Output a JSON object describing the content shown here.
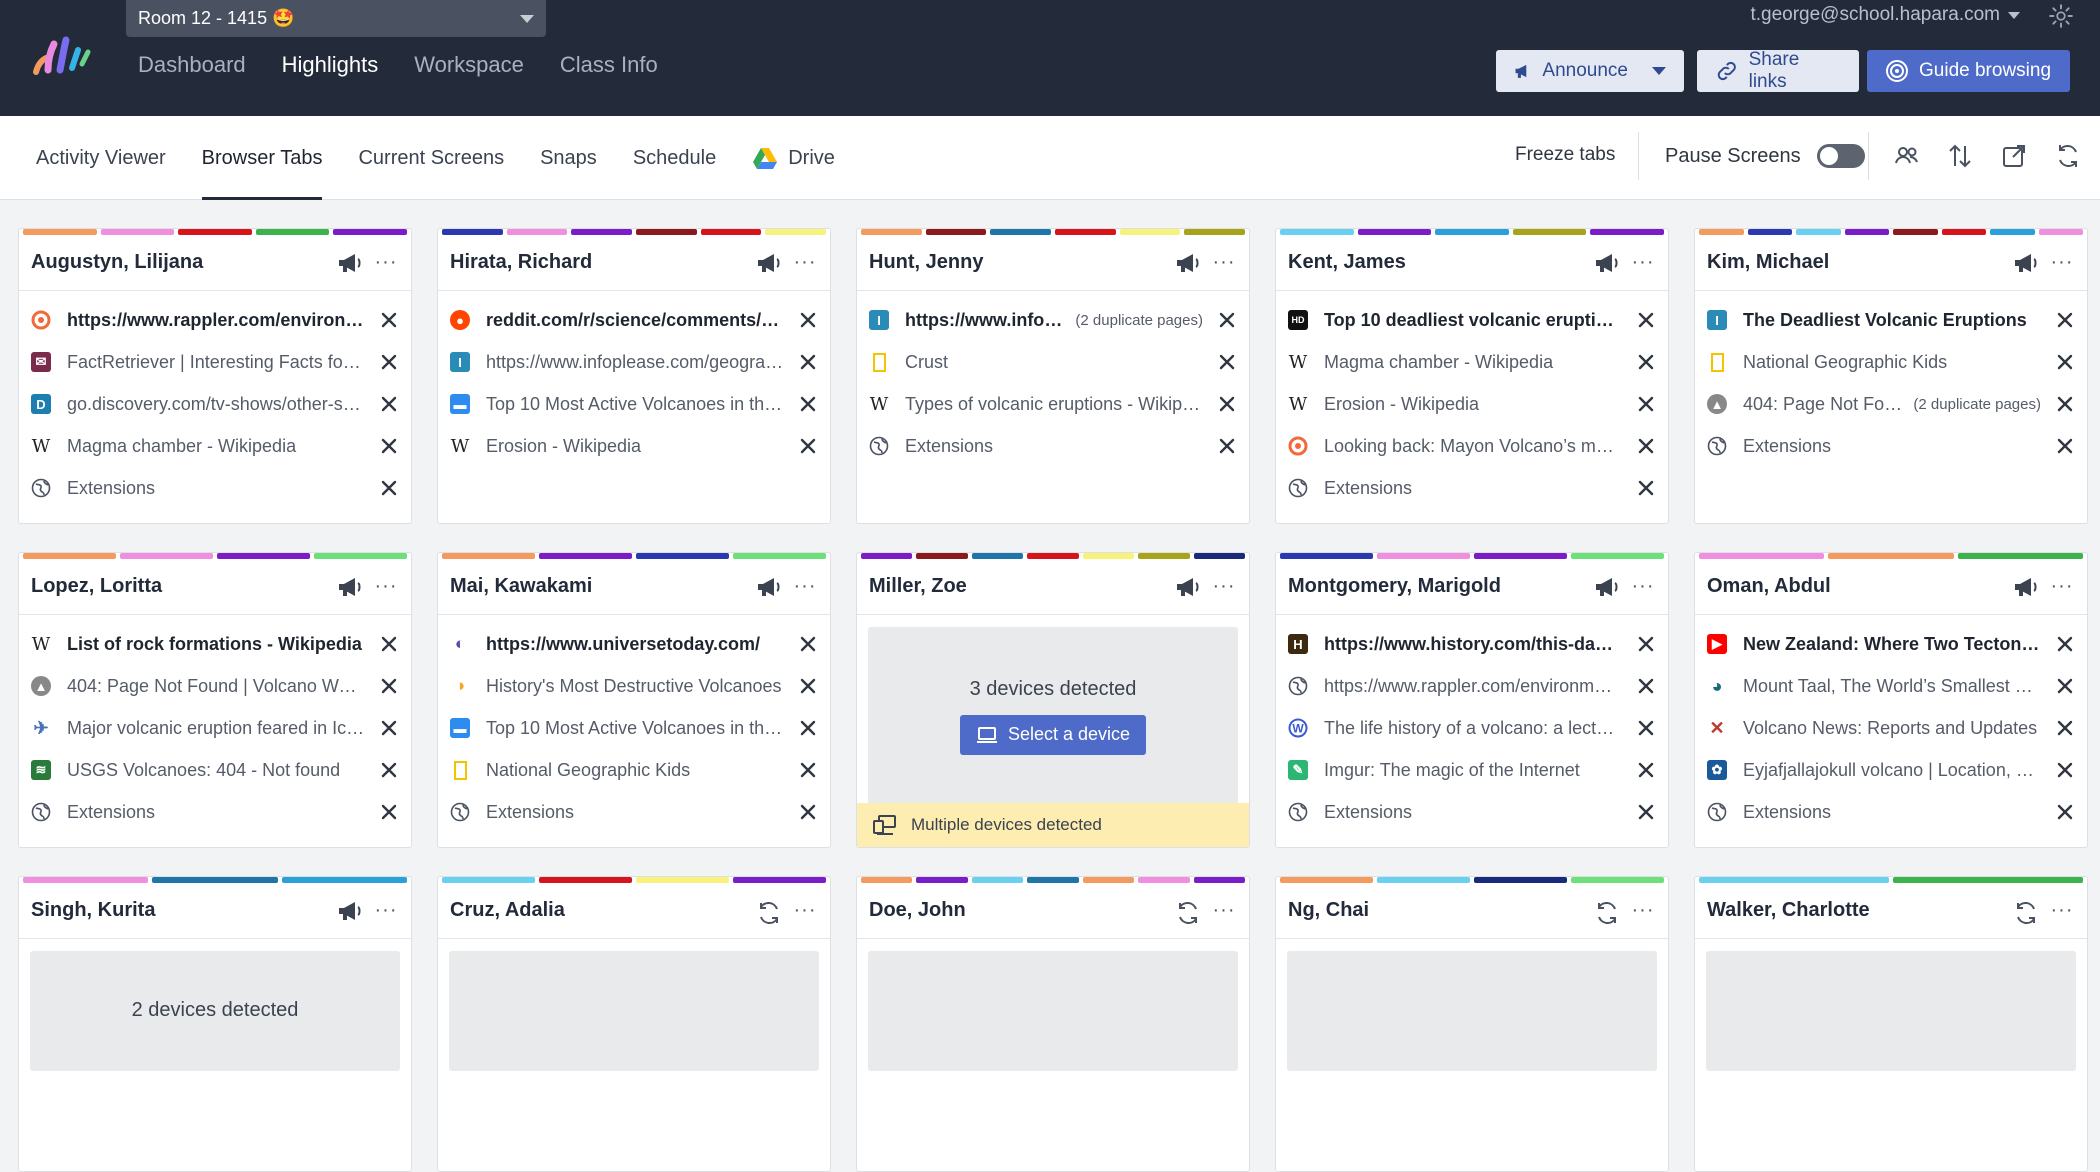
{
  "header": {
    "room": "Room 12 - 1415 🤩",
    "nav": [
      "Dashboard",
      "Highlights",
      "Workspace",
      "Class Info"
    ],
    "active_nav": "Highlights",
    "user": "t.george@school.hapara.com",
    "buttons": {
      "announce": "Announce",
      "share": "Share links",
      "guide": "Guide browsing"
    }
  },
  "subnav": {
    "tabs": [
      "Activity Viewer",
      "Browser Tabs",
      "Current Screens",
      "Snaps",
      "Schedule",
      "Drive"
    ],
    "active": "Browser Tabs",
    "freeze": "Freeze tabs",
    "pause": "Pause Screens"
  },
  "colors": {
    "brand": "#232b3a",
    "accent": "#4e6bc9"
  },
  "students": [
    {
      "name": "Augustyn, Lilijana",
      "stripe": [
        "#f39a5f",
        "#f08ee0",
        "#d5141c",
        "#3bb34a",
        "#7a1cc8"
      ],
      "head_icon": "announce",
      "tabs": [
        {
          "title": "https://www.rappler.com/environment/...",
          "icon": "rappler"
        },
        {
          "title": "FactRetriever | Interesting Facts for Kids",
          "icon": "factretriever"
        },
        {
          "title": "go.discovery.com/tv-shows/other-shows",
          "icon": "discovery"
        },
        {
          "title": "Magma chamber - Wikipedia",
          "icon": "wikipedia"
        },
        {
          "title": "Extensions",
          "icon": "globe"
        }
      ]
    },
    {
      "name": "Hirata, Richard",
      "stripe": [
        "#2a39b0",
        "#f08ee0",
        "#7a1cc8",
        "#8b1a1f",
        "#d5141c",
        "#f7f37a"
      ],
      "head_icon": "announce",
      "tabs": [
        {
          "title": "reddit.com/r/science/comments/volcano",
          "icon": "reddit"
        },
        {
          "title": "https://www.infoplease.com/geography/volcanoes",
          "icon": "infoplease"
        },
        {
          "title": "Top 10 Most Active Volcanoes in the World",
          "icon": "chat"
        },
        {
          "title": "Erosion - Wikipedia",
          "icon": "wikipedia"
        }
      ]
    },
    {
      "name": "Hunt, Jenny",
      "stripe": [
        "#f39a5f",
        "#8b1a1f",
        "#1f74a8",
        "#d5141c",
        "#f7f37a",
        "#a8a41a"
      ],
      "head_icon": "announce",
      "tabs": [
        {
          "title": "https://www.infoplease.com/",
          "icon": "infoplease",
          "dup": "(2 duplicate pages)"
        },
        {
          "title": "Crust",
          "icon": "natgeo"
        },
        {
          "title": "Types of volcanic eruptions - Wikipedia",
          "icon": "wikipedia"
        },
        {
          "title": "Extensions",
          "icon": "globe"
        }
      ]
    },
    {
      "name": "Kent, James",
      "stripe": [
        "#6ad0f0",
        "#7a1cc8",
        "#2aa0d8",
        "#a8a41a",
        "#7a1cc8"
      ],
      "head_icon": "announce",
      "tabs": [
        {
          "title": "Top 10 deadliest volcanic eruptions",
          "icon": "hd"
        },
        {
          "title": "Magma chamber - Wikipedia",
          "icon": "wikipedia"
        },
        {
          "title": "Erosion - Wikipedia",
          "icon": "wikipedia"
        },
        {
          "title": "Looking back: Mayon Volcano’s most...",
          "icon": "rappler"
        },
        {
          "title": "Extensions",
          "icon": "globe"
        }
      ]
    },
    {
      "name": "Kim, Michael",
      "stripe": [
        "#f39a5f",
        "#2a39b0",
        "#6ad0f0",
        "#7a1cc8",
        "#8b1a1f",
        "#d5141c",
        "#2aa0d8",
        "#f08ee0"
      ],
      "head_icon": "announce",
      "tabs": [
        {
          "title": "The Deadliest Volcanic Eruptions",
          "icon": "infoplease"
        },
        {
          "title": "National Geographic Kids",
          "icon": "natgeo"
        },
        {
          "title": "404: Page Not Found",
          "icon": "volcano",
          "dup": "(2 duplicate pages)"
        },
        {
          "title": "Extensions",
          "icon": "globe"
        }
      ]
    },
    {
      "name": "Lopez, Loritta",
      "stripe": [
        "#f39a5f",
        "#f08ee0",
        "#7a1cc8",
        "#6ee07a"
      ],
      "head_icon": "announce",
      "tabs": [
        {
          "title": "List of rock formations - Wikipedia",
          "icon": "wikipedia"
        },
        {
          "title": "404: Page Not Found | Volcano World",
          "icon": "volcano"
        },
        {
          "title": "Major volcanic eruption feared in Iceland",
          "icon": "bird"
        },
        {
          "title": "USGS Volcanoes: 404 - Not found",
          "icon": "usgs"
        },
        {
          "title": "Extensions",
          "icon": "globe"
        }
      ]
    },
    {
      "name": "Mai, Kawakami",
      "stripe": [
        "#f39a5f",
        "#7a1cc8",
        "#2a39b0",
        "#6ee07a"
      ],
      "head_icon": "announce",
      "tabs": [
        {
          "title": "https://www.universetoday.com/",
          "icon": "universe"
        },
        {
          "title": "History's Most Destructive Volcanoes",
          "icon": "sun"
        },
        {
          "title": "Top 10 Most Active Volcanoes in the World",
          "icon": "chat"
        },
        {
          "title": "National Geographic Kids",
          "icon": "natgeo"
        },
        {
          "title": "Extensions",
          "icon": "globe"
        }
      ]
    },
    {
      "name": "Miller, Zoe",
      "stripe": [
        "#7a1cc8",
        "#8b1a1f",
        "#1f74a8",
        "#d5141c",
        "#f7f37a",
        "#a8a41a",
        "#1a2a7a"
      ],
      "head_icon": "announce",
      "devices": "3 devices detected",
      "select": "Select a device",
      "notice": "Multiple devices detected"
    },
    {
      "name": "Montgomery, Marigold",
      "stripe": [
        "#2a39b0",
        "#f08ee0",
        "#7a1cc8",
        "#6ee07a"
      ],
      "head_icon": "announce",
      "tabs": [
        {
          "title": "https://www.history.com/this-day-in-history",
          "icon": "history"
        },
        {
          "title": "https://www.rappler.com/environment/",
          "icon": "globe"
        },
        {
          "title": "The life history of a volcano: a lecture",
          "icon": "wordpress"
        },
        {
          "title": "Imgur: The magic of the Internet",
          "icon": "imgur"
        },
        {
          "title": "Extensions",
          "icon": "globe"
        }
      ]
    },
    {
      "name": "Oman, Abdul",
      "stripe": [
        "#f08ee0",
        "#f39a5f",
        "#3bb34a"
      ],
      "head_icon": "announce",
      "tabs": [
        {
          "title": "New Zealand: Where Two Tectonic Plates Meet",
          "icon": "youtube"
        },
        {
          "title": "Mount Taal, The World’s Smallest Volcano",
          "icon": "taal"
        },
        {
          "title": "Volcano News: Reports and Updates",
          "icon": "volcnews"
        },
        {
          "title": "Eyjafjallajokull volcano | Location, Eruption",
          "icon": "britannica"
        },
        {
          "title": "Extensions",
          "icon": "globe"
        }
      ]
    },
    {
      "name": "Singh, Kurita",
      "stripe": [
        "#f08ee0",
        "#1f74a8",
        "#2aa0d8"
      ],
      "head_icon": "announce",
      "devices": "2 devices detected"
    },
    {
      "name": "Cruz, Adalia",
      "stripe": [
        "#6ad0f0",
        "#d5141c",
        "#f7f37a",
        "#7a1cc8"
      ],
      "head_icon": "refresh",
      "devices": ""
    },
    {
      "name": "Doe, John",
      "stripe": [
        "#f39a5f",
        "#7a1cc8",
        "#6ad0f0",
        "#1f74a8",
        "#f39a5f",
        "#f08ee0",
        "#7a1cc8"
      ],
      "head_icon": "refresh",
      "devices": ""
    },
    {
      "name": "Ng, Chai",
      "stripe": [
        "#f39a5f",
        "#6ad0f0",
        "#1a2a7a",
        "#6ee07a"
      ],
      "head_icon": "refresh",
      "devices": ""
    },
    {
      "name": "Walker, Charlotte",
      "stripe": [
        "#6ad0f0",
        "#3bb34a"
      ],
      "head_icon": "refresh",
      "devices": ""
    }
  ]
}
